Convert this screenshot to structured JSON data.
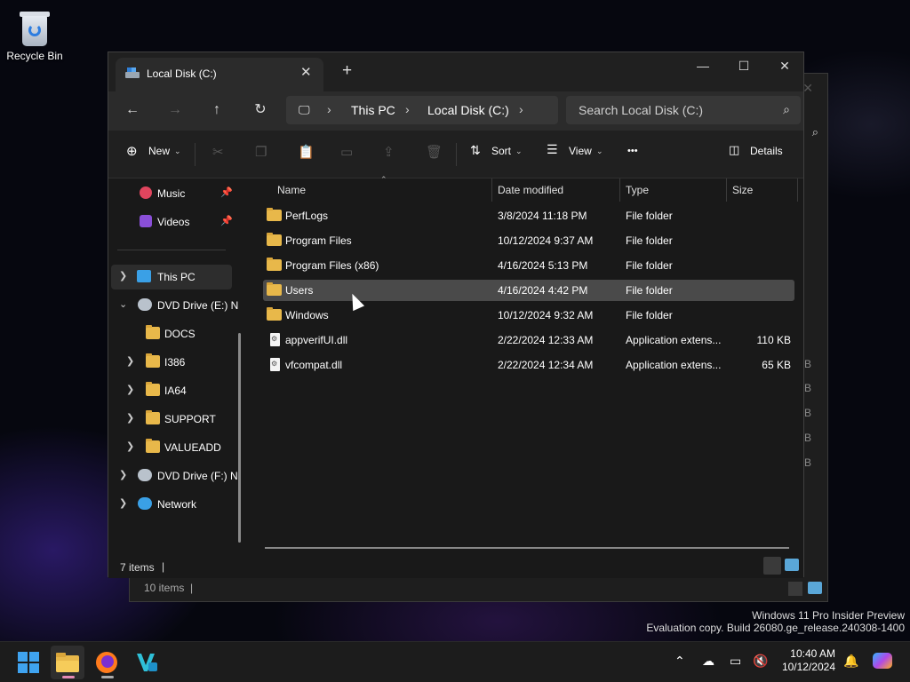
{
  "desktop": {
    "recycle_bin_label": "Recycle Bin"
  },
  "background_window": {
    "status_text": "10 items",
    "size_fragments": [
      "KB",
      "KB",
      "KB",
      "KB",
      "KB"
    ]
  },
  "window": {
    "tab_title": "Local Disk (C:)",
    "new_tab_label": "+",
    "minimize_label": "—",
    "maximize_label": "☐",
    "close_label": "✕",
    "tab_close_label": "✕"
  },
  "navbar": {
    "back_icon": "←",
    "forward_icon": "→",
    "up_icon": "↑",
    "refresh_icon": "↻",
    "breadcrumb": [
      "This PC",
      "Local Disk (C:)"
    ],
    "search_placeholder": "Search Local Disk (C:)"
  },
  "commandbar": {
    "new_label": "New",
    "sort_label": "Sort",
    "view_label": "View",
    "more_label": "•••",
    "details_label": "Details"
  },
  "navpane": {
    "quick_access": [
      {
        "label": "Music",
        "icon": "music-icon"
      },
      {
        "label": "Videos",
        "icon": "videos-icon"
      }
    ],
    "tree": [
      {
        "label": "This PC"
      },
      {
        "label": "DVD Drive (E:) N"
      },
      {
        "label": "DOCS"
      },
      {
        "label": "I386"
      },
      {
        "label": "IA64"
      },
      {
        "label": "SUPPORT"
      },
      {
        "label": "VALUEADD"
      },
      {
        "label": "DVD Drive (F:) N"
      },
      {
        "label": "Network"
      }
    ]
  },
  "content": {
    "columns": [
      "Name",
      "Date modified",
      "Type",
      "Size"
    ],
    "rows": [
      {
        "name": "PerfLogs",
        "date": "3/8/2024 11:18 PM",
        "type": "File folder",
        "size": ""
      },
      {
        "name": "Program Files",
        "date": "10/12/2024 9:37 AM",
        "type": "File folder",
        "size": ""
      },
      {
        "name": "Program Files (x86)",
        "date": "4/16/2024 5:13 PM",
        "type": "File folder",
        "size": ""
      },
      {
        "name": "Users",
        "date": "4/16/2024 4:42 PM",
        "type": "File folder",
        "size": ""
      },
      {
        "name": "Windows",
        "date": "10/12/2024 9:32 AM",
        "type": "File folder",
        "size": ""
      },
      {
        "name": "appverifUI.dll",
        "date": "2/22/2024 12:33 AM",
        "type": "Application extens...",
        "size": "110 KB"
      },
      {
        "name": "vfcompat.dll",
        "date": "2/22/2024 12:34 AM",
        "type": "Application extens...",
        "size": "65 KB"
      }
    ]
  },
  "statusbar": {
    "item_count": "7 items",
    "caret": "|"
  },
  "watermark": {
    "line1": "Windows 11 Pro Insider Preview",
    "line2": "Evaluation copy. Build 26080.ge_release.240308-1400"
  },
  "taskbar": {
    "time": "10:40 AM",
    "date": "10/12/2024"
  }
}
